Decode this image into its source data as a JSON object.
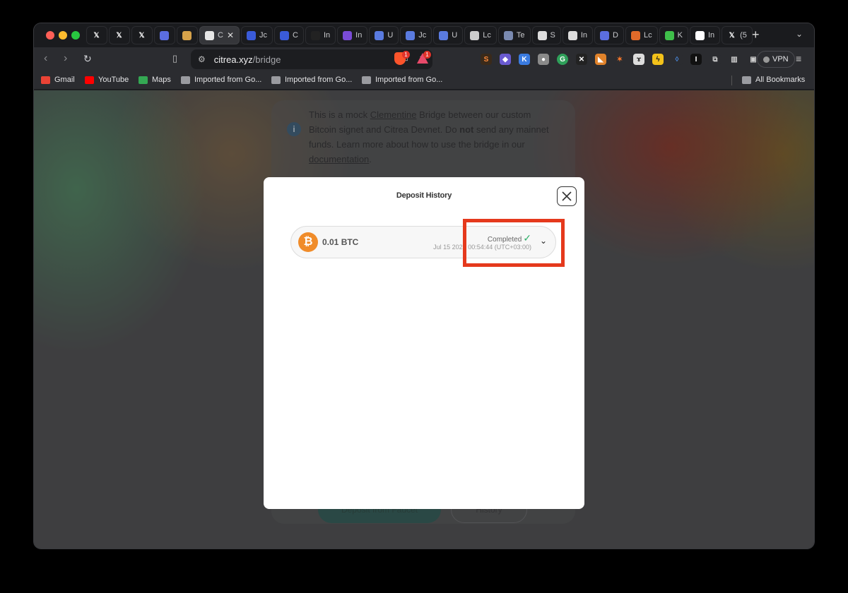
{
  "browser": {
    "tabs": [
      {
        "icon": "x-logo-icon",
        "label": "",
        "color": "#000000"
      },
      {
        "icon": "x-logo-icon",
        "label": "",
        "color": "#000000"
      },
      {
        "icon": "x-logo-icon",
        "label": "",
        "color": "#000000"
      },
      {
        "icon": "app-icon",
        "label": "",
        "color": "#5b6ee0"
      },
      {
        "icon": "doc-icon",
        "label": "",
        "color": "#d6a24a"
      },
      {
        "icon": "page-icon",
        "label": "C",
        "color": "#e6e6e6",
        "active": true
      },
      {
        "icon": "bird-icon",
        "label": "Jc",
        "color": "#3a5bd9"
      },
      {
        "icon": "bird-icon",
        "label": "C",
        "color": "#3a5bd9"
      },
      {
        "icon": "spy-icon",
        "label": "In",
        "color": "#222222"
      },
      {
        "icon": "cube-icon",
        "label": "In",
        "color": "#7a4bd6"
      },
      {
        "icon": "circle-icon",
        "label": "U",
        "color": "#5a7be0"
      },
      {
        "icon": "circle-icon",
        "label": "Jc",
        "color": "#5a7be0"
      },
      {
        "icon": "circle-icon",
        "label": "U",
        "color": "#5a7be0"
      },
      {
        "icon": "ring-icon",
        "label": "Lc",
        "color": "#cccccc"
      },
      {
        "icon": "globe-icon",
        "label": "Te",
        "color": "#7a8ab0"
      },
      {
        "icon": "figure-icon",
        "label": "S",
        "color": "#dddddd"
      },
      {
        "icon": "info-icon",
        "label": "In",
        "color": "#dddddd"
      },
      {
        "icon": "circle-icon",
        "label": "D",
        "color": "#5b6ee0"
      },
      {
        "icon": "fox-icon",
        "label": "Lc",
        "color": "#e06a2a"
      },
      {
        "icon": "k-icon",
        "label": "K",
        "color": "#3fbf4a"
      },
      {
        "icon": "info-icon",
        "label": "In",
        "color": "#ffffff"
      },
      {
        "icon": "x-logo-icon",
        "label": "(5",
        "color": "#000000"
      }
    ],
    "active_tab_label": "C",
    "url_host": "citrea.xyz",
    "url_path": "/bridge",
    "brave_badge": "1",
    "rewards_badge": "1",
    "vpn_label": "VPN",
    "bookmarks": [
      {
        "label": "Gmail",
        "icon": "gmail-icon",
        "color": "#ea4335"
      },
      {
        "label": "YouTube",
        "icon": "youtube-icon",
        "color": "#ff0000"
      },
      {
        "label": "Maps",
        "icon": "maps-icon",
        "color": "#34a853"
      },
      {
        "label": "Imported from Go...",
        "icon": "folder-icon"
      },
      {
        "label": "Imported from Go...",
        "icon": "folder-icon"
      },
      {
        "label": "Imported from Go...",
        "icon": "folder-icon"
      }
    ],
    "all_bookmarks": "All Bookmarks"
  },
  "page": {
    "notice_prefix": "This is a mock ",
    "notice_link1": "Clementine",
    "notice_mid1": " Bridge between our custom Bitcoin signet and Citrea Devnet. Do ",
    "notice_bold": "not",
    "notice_mid2": " send any mainnet funds. Learn more about how to use the bridge in our ",
    "notice_link2": "documentation",
    "notice_end": ".",
    "faucet_button": "Deposit from Faucet",
    "history_button": "History"
  },
  "modal": {
    "title": "Deposit History",
    "deposits": [
      {
        "amount": "0.01 BTC",
        "status": "Completed",
        "date": "Jul 15 2024 00:54:44 (UTC+03:00)"
      }
    ]
  },
  "colors": {
    "highlight": "#e5391c",
    "bitcoin": "#f08c2a",
    "success": "#2fb06a"
  }
}
